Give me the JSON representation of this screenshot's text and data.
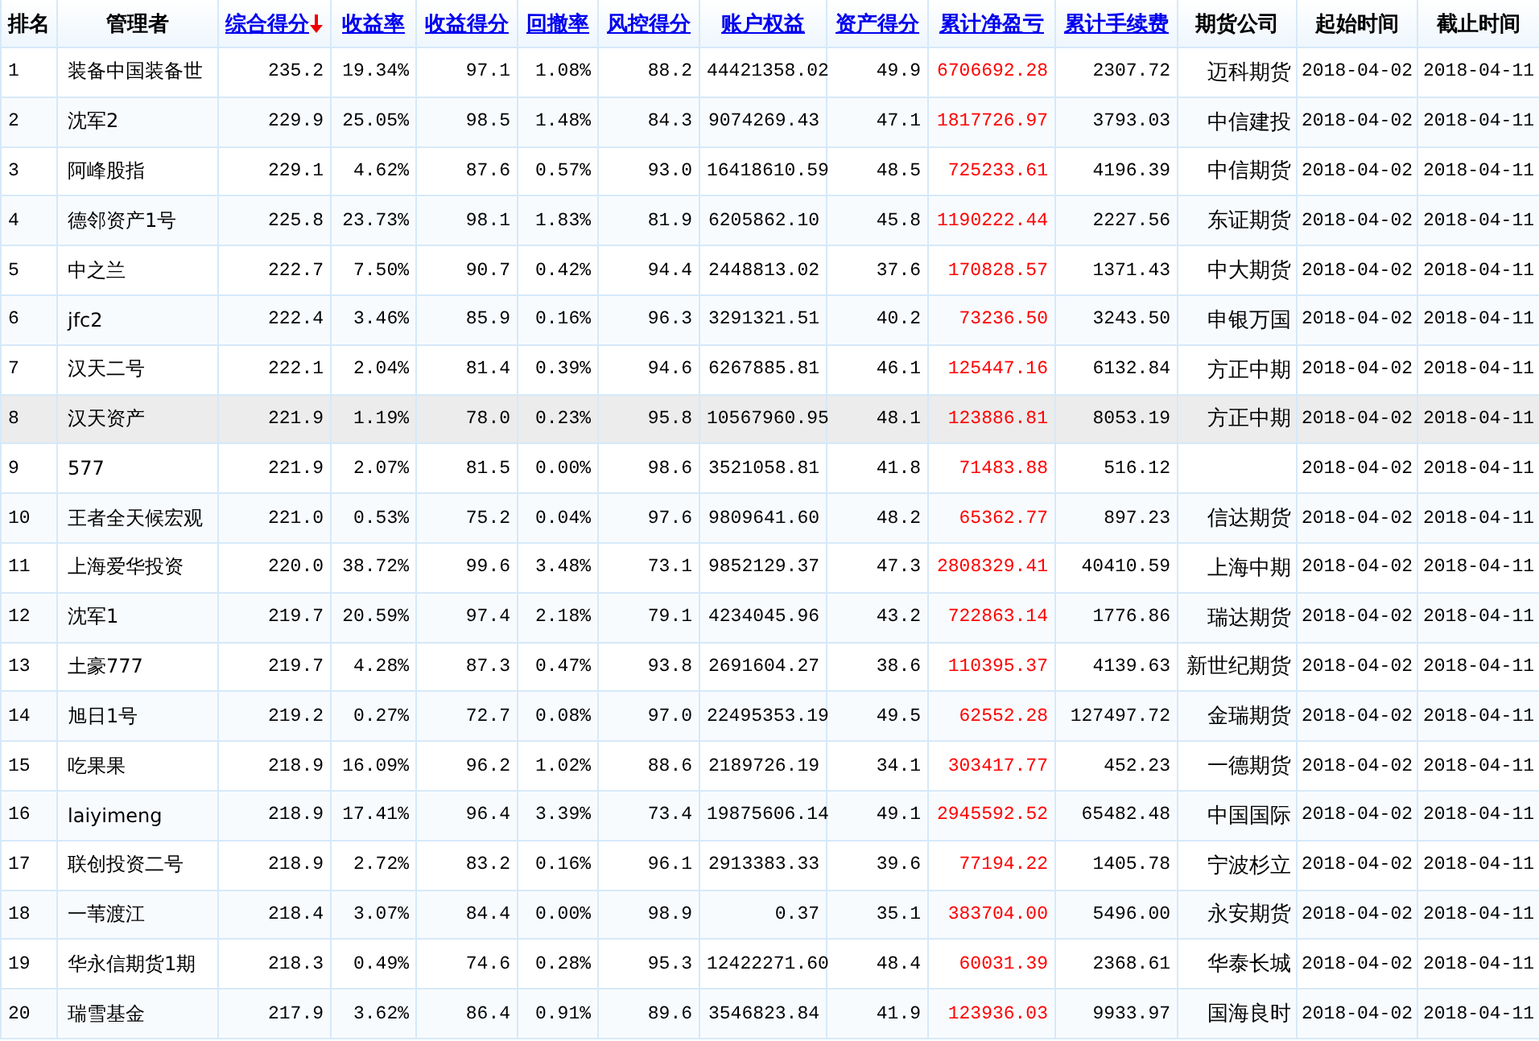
{
  "table": {
    "columns": [
      {
        "label": "排名",
        "kind": "rank",
        "link": false,
        "sorted": false
      },
      {
        "label": "管理者",
        "kind": "name",
        "link": false,
        "sorted": false
      },
      {
        "label": "综合得分",
        "kind": "number",
        "link": true,
        "sorted": true
      },
      {
        "label": "收益率",
        "kind": "number",
        "link": true,
        "sorted": false
      },
      {
        "label": "收益得分",
        "kind": "number",
        "link": true,
        "sorted": false
      },
      {
        "label": "回撤率",
        "kind": "number",
        "link": true,
        "sorted": false
      },
      {
        "label": "风控得分",
        "kind": "number",
        "link": true,
        "sorted": false
      },
      {
        "label": "账户权益",
        "kind": "number",
        "link": true,
        "sorted": false
      },
      {
        "label": "资产得分",
        "kind": "number",
        "link": true,
        "sorted": false
      },
      {
        "label": "累计净盈亏",
        "kind": "gain",
        "link": true,
        "sorted": false
      },
      {
        "label": "累计手续费",
        "kind": "number",
        "link": true,
        "sorted": false
      },
      {
        "label": "期货公司",
        "kind": "company",
        "link": false,
        "sorted": false
      },
      {
        "label": "起始时间",
        "kind": "date",
        "link": false,
        "sorted": false
      },
      {
        "label": "截止时间",
        "kind": "date",
        "link": false,
        "sorted": false
      }
    ],
    "rows": [
      {
        "selected": false,
        "cells": [
          "1",
          "装备中国装备世",
          "235.2",
          "19.34%",
          "97.1",
          "1.08%",
          "88.2",
          "44421358.02",
          "49.9",
          "6706692.28",
          "2307.72",
          "迈科期货",
          "2018-04-02",
          "2018-04-11"
        ]
      },
      {
        "selected": false,
        "cells": [
          "2",
          "沈军2",
          "229.9",
          "25.05%",
          "98.5",
          "1.48%",
          "84.3",
          "9074269.43",
          "47.1",
          "1817726.97",
          "3793.03",
          "中信建投",
          "2018-04-02",
          "2018-04-11"
        ]
      },
      {
        "selected": false,
        "cells": [
          "3",
          "阿峰股指",
          "229.1",
          "4.62%",
          "87.6",
          "0.57%",
          "93.0",
          "16418610.59",
          "48.5",
          "725233.61",
          "4196.39",
          "中信期货",
          "2018-04-02",
          "2018-04-11"
        ]
      },
      {
        "selected": false,
        "cells": [
          "4",
          "德邻资产1号",
          "225.8",
          "23.73%",
          "98.1",
          "1.83%",
          "81.9",
          "6205862.10",
          "45.8",
          "1190222.44",
          "2227.56",
          "东证期货",
          "2018-04-02",
          "2018-04-11"
        ]
      },
      {
        "selected": false,
        "cells": [
          "5",
          "中之兰",
          "222.7",
          "7.50%",
          "90.7",
          "0.42%",
          "94.4",
          "2448813.02",
          "37.6",
          "170828.57",
          "1371.43",
          "中大期货",
          "2018-04-02",
          "2018-04-11"
        ]
      },
      {
        "selected": false,
        "cells": [
          "6",
          "jfc2",
          "222.4",
          "3.46%",
          "85.9",
          "0.16%",
          "96.3",
          "3291321.51",
          "40.2",
          "73236.50",
          "3243.50",
          "申银万国",
          "2018-04-02",
          "2018-04-11"
        ]
      },
      {
        "selected": false,
        "cells": [
          "7",
          "汉天二号",
          "222.1",
          "2.04%",
          "81.4",
          "0.39%",
          "94.6",
          "6267885.81",
          "46.1",
          "125447.16",
          "6132.84",
          "方正中期",
          "2018-04-02",
          "2018-04-11"
        ]
      },
      {
        "selected": true,
        "cells": [
          "8",
          "汉天资产",
          "221.9",
          "1.19%",
          "78.0",
          "0.23%",
          "95.8",
          "10567960.95",
          "48.1",
          "123886.81",
          "8053.19",
          "方正中期",
          "2018-04-02",
          "2018-04-11"
        ]
      },
      {
        "selected": false,
        "cells": [
          "9",
          "577",
          "221.9",
          "2.07%",
          "81.5",
          "0.00%",
          "98.6",
          "3521058.81",
          "41.8",
          "71483.88",
          "516.12",
          null,
          "2018-04-02",
          "2018-04-11"
        ]
      },
      {
        "selected": false,
        "cells": [
          "10",
          "王者全天候宏观",
          "221.0",
          "0.53%",
          "75.2",
          "0.04%",
          "97.6",
          "9809641.60",
          "48.2",
          "65362.77",
          "897.23",
          "信达期货",
          "2018-04-02",
          "2018-04-11"
        ]
      },
      {
        "selected": false,
        "cells": [
          "11",
          "上海爱华投资",
          "220.0",
          "38.72%",
          "99.6",
          "3.48%",
          "73.1",
          "9852129.37",
          "47.3",
          "2808329.41",
          "40410.59",
          "上海中期",
          "2018-04-02",
          "2018-04-11"
        ]
      },
      {
        "selected": false,
        "cells": [
          "12",
          "沈军1",
          "219.7",
          "20.59%",
          "97.4",
          "2.18%",
          "79.1",
          "4234045.96",
          "43.2",
          "722863.14",
          "1776.86",
          "瑞达期货",
          "2018-04-02",
          "2018-04-11"
        ]
      },
      {
        "selected": false,
        "cells": [
          "13",
          "土豪777",
          "219.7",
          "4.28%",
          "87.3",
          "0.47%",
          "93.8",
          "2691604.27",
          "38.6",
          "110395.37",
          "4139.63",
          "新世纪期货",
          "2018-04-02",
          "2018-04-11"
        ]
      },
      {
        "selected": false,
        "cells": [
          "14",
          "旭日1号",
          "219.2",
          "0.27%",
          "72.7",
          "0.08%",
          "97.0",
          "22495353.19",
          "49.5",
          "62552.28",
          "127497.72",
          "金瑞期货",
          "2018-04-02",
          "2018-04-11"
        ]
      },
      {
        "selected": false,
        "cells": [
          "15",
          "吃果果",
          "218.9",
          "16.09%",
          "96.2",
          "1.02%",
          "88.6",
          "2189726.19",
          "34.1",
          "303417.77",
          "452.23",
          "一德期货",
          "2018-04-02",
          "2018-04-11"
        ]
      },
      {
        "selected": false,
        "cells": [
          "16",
          "laiyimeng",
          "218.9",
          "17.41%",
          "96.4",
          "3.39%",
          "73.4",
          "19875606.14",
          "49.1",
          "2945592.52",
          "65482.48",
          "中国国际",
          "2018-04-02",
          "2018-04-11"
        ]
      },
      {
        "selected": false,
        "cells": [
          "17",
          "联创投资二号",
          "218.9",
          "2.72%",
          "83.2",
          "0.16%",
          "96.1",
          "2913383.33",
          "39.6",
          "77194.22",
          "1405.78",
          "宁波杉立",
          "2018-04-02",
          "2018-04-11"
        ]
      },
      {
        "selected": false,
        "cells": [
          "18",
          "一苇渡江",
          "218.4",
          "3.07%",
          "84.4",
          "0.00%",
          "98.9",
          "0.37",
          "35.1",
          "383704.00",
          "5496.00",
          "永安期货",
          "2018-04-02",
          "2018-04-11"
        ]
      },
      {
        "selected": false,
        "cells": [
          "19",
          "华永信期货1期",
          "218.3",
          "0.49%",
          "74.6",
          "0.28%",
          "95.3",
          "12422271.60",
          "48.4",
          "60031.39",
          "2368.61",
          "华泰长城",
          "2018-04-02",
          "2018-04-11"
        ]
      },
      {
        "selected": false,
        "cells": [
          "20",
          "瑞雪基金",
          "217.9",
          "3.62%",
          "86.4",
          "0.91%",
          "89.6",
          "3546823.84",
          "41.9",
          "123936.03",
          "9933.97",
          "国海良时",
          "2018-04-02",
          "2018-04-11"
        ]
      }
    ]
  }
}
